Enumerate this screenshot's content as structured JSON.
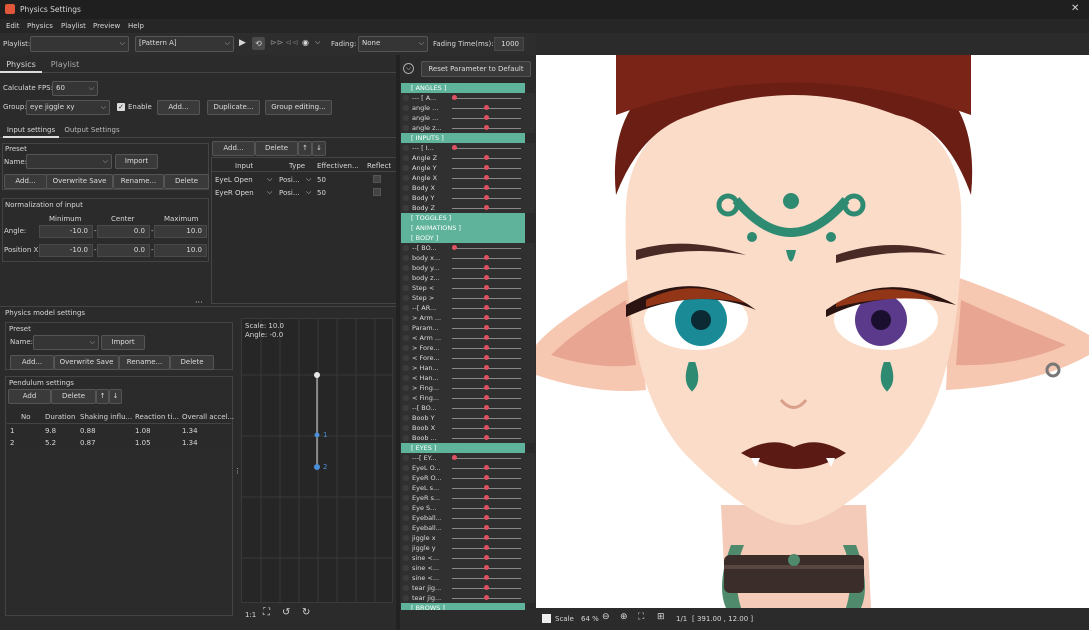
{
  "window": {
    "title": "Physics Settings",
    "close": "✕"
  },
  "menu": [
    "Edit",
    "Physics",
    "Playlist",
    "Preview",
    "Help"
  ],
  "toolbar": {
    "playlist_label": "Playlist:",
    "playlist_value": "",
    "pattern_value": "[Pattern A]",
    "fading_label": "Fading:",
    "fading_value": "None",
    "fading_time_label": "Fading Time(ms):",
    "fading_time_value": "1000"
  },
  "tabs": {
    "physics": "Physics",
    "playlist": "Playlist"
  },
  "fps": {
    "label": "Calculate FPS:",
    "value": "60"
  },
  "group": {
    "label": "Group:",
    "value": "eye jiggle xy",
    "enable": "Enable",
    "add": "Add...",
    "duplicate": "Duplicate...",
    "group_editing": "Group editing..."
  },
  "subtabs": {
    "input": "Input settings",
    "output": "Output Settings"
  },
  "preset": {
    "title": "Preset",
    "name_label": "Name:",
    "import": "Import",
    "add": "Add...",
    "overwrite": "Overwrite Save",
    "rename": "Rename...",
    "delete": "Delete"
  },
  "input_table": {
    "add": "Add...",
    "delete": "Delete",
    "up": "↑",
    "down": "↓",
    "headers": [
      "Input",
      "Type",
      "Effectiven...",
      "Reflect"
    ],
    "rows": [
      [
        "EyeL Open",
        "Posi...",
        "50"
      ],
      [
        "EyeR Open",
        "Posi...",
        "50"
      ]
    ]
  },
  "normalization": {
    "title": "Normalization of input",
    "min": "Minimum",
    "center": "Center",
    "max": "Maximum",
    "rows": [
      {
        "label": "Angle:",
        "min": "-10.0",
        "center": "0.0",
        "max": "10.0"
      },
      {
        "label": "Position X:",
        "min": "-10.0",
        "center": "0.0",
        "max": "10.0"
      }
    ]
  },
  "model": {
    "title": "Physics model settings",
    "preset_title": "Preset",
    "name_label": "Name:",
    "import": "Import",
    "add": "Add...",
    "overwrite": "Overwrite Save",
    "rename": "Rename...",
    "delete": "Delete"
  },
  "pendulum": {
    "title": "Pendulum settings",
    "add": "Add",
    "delete": "Delete",
    "up": "↑",
    "down": "↓",
    "headers": [
      "No",
      "Duration",
      "Shaking influ...",
      "Reaction ti...",
      "Overall accel..."
    ],
    "rows": [
      [
        "1",
        "9.8",
        "0.88",
        "1.08",
        "1.34"
      ],
      [
        "2",
        "5.2",
        "0.87",
        "1.05",
        "1.34"
      ]
    ]
  },
  "preview_pendulum": {
    "scale": "Scale: 10.0",
    "angle": "Angle: -0.0",
    "node1": "1",
    "node2": "2",
    "ratio": "1:1"
  },
  "params": {
    "reset": "Reset Parameter to Default",
    "groups": [
      {
        "title": "[ ANGLES ]",
        "items": [
          "--- [ A...",
          "angle ...",
          "angle ...",
          "angle z..."
        ]
      },
      {
        "title": "[ INPUTS ]",
        "items": [
          "--- [ I...",
          "Angle Z",
          "Angle Y",
          "Angle X",
          "Body X",
          "Body Y",
          "Body Z"
        ]
      },
      {
        "title": "[ TOGGLES ]",
        "items": []
      },
      {
        "title": "[ ANIMATIONS ]",
        "items": []
      },
      {
        "title": "[ BODY ]",
        "items": [
          "--[ BO...",
          "body x...",
          "body y...",
          "body z...",
          "Step <",
          "Step >",
          "--[ AR...",
          "> Arm ...",
          "Param...",
          "< Arm ...",
          "> Fore...",
          "< Fore...",
          "> Han...",
          "< Han...",
          "> Fing...",
          "< Fing...",
          "--[ BO...",
          "Boob Y",
          "Boob X",
          "Boob ..."
        ]
      },
      {
        "title": "[ EYES ]",
        "items": [
          "---[ EY...",
          "EyeL O...",
          "EyeR O...",
          "EyeL s...",
          "EyeR s...",
          "Eye S...",
          "Eyeball...",
          "Eyeball...",
          "jiggle x",
          "jiggle y",
          "sine <...",
          "sine <...",
          "sine <...",
          "tear jig...",
          "tear jig..."
        ]
      },
      {
        "title": "[ BROWS ]",
        "items": []
      }
    ]
  },
  "canvas": {
    "scale_label": "Scale",
    "zoom": "64 %",
    "page": "1/1",
    "coords": "[ 391.00 ,  12.00 ]"
  },
  "colors": {
    "accent": "#5fb39a",
    "knob": "#e05060",
    "bg": "#2b2b2b"
  }
}
